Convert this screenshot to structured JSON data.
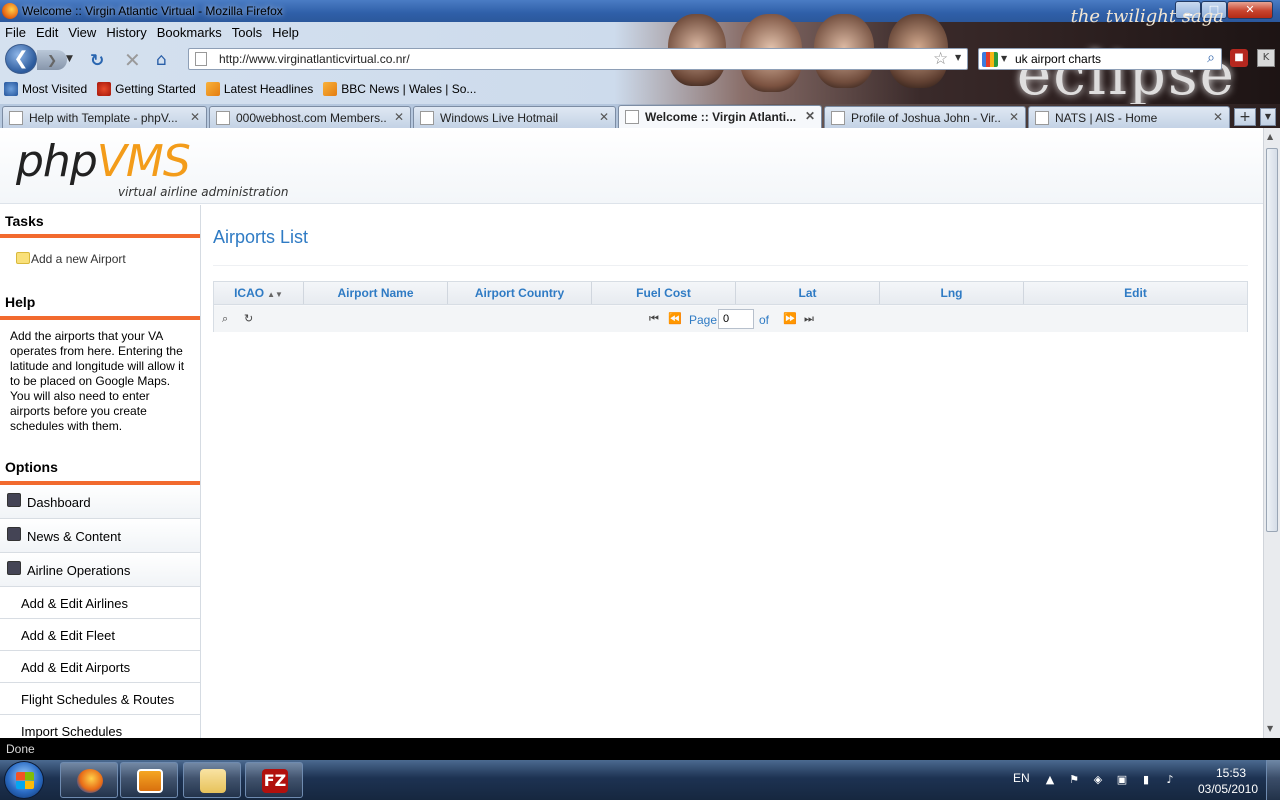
{
  "window": {
    "title": "Welcome :: Virgin Atlantic Virtual - Mozilla Firefox",
    "min_glyph": "▁",
    "max_glyph": "□",
    "close_glyph": "✕"
  },
  "menubar": [
    "File",
    "Edit",
    "View",
    "History",
    "Bookmarks",
    "Tools",
    "Help"
  ],
  "navbar": {
    "url": "http://www.virginatlanticvirtual.co.nr/",
    "search_query": "uk airport charts"
  },
  "persona": {
    "saga_text": "the twilight saga",
    "brand_text": "eclipse"
  },
  "bookmarks": [
    "Most Visited",
    "Getting Started",
    "Latest Headlines",
    "BBC News | Wales | So..."
  ],
  "tabs": [
    {
      "label": "Help with Template - phpV...",
      "active": false
    },
    {
      "label": "000webhost.com Members...",
      "active": false
    },
    {
      "label": "Windows Live Hotmail",
      "active": false
    },
    {
      "label": "Welcome :: Virgin Atlanti...",
      "active": true
    },
    {
      "label": "Profile of Joshua John - Vir...",
      "active": false
    },
    {
      "label": "NATS | AIS - Home",
      "active": false
    }
  ],
  "site": {
    "logo_php": "php",
    "logo_vms": "VMS",
    "tagline": "virtual airline administration"
  },
  "sidebar": {
    "tasks_heading": "Tasks",
    "task_add_airport": "Add a new Airport",
    "help_heading": "Help",
    "help_text": "Add the airports that your VA operates from here. Entering the latitude and longitude will allow it to be placed on Google Maps. You will also need to enter airports before you create schedules with them.",
    "options_heading": "Options",
    "options": [
      "Dashboard",
      "News & Content",
      "Airline Operations"
    ],
    "sub_options": [
      "Add & Edit Airlines",
      "Add & Edit Fleet",
      "Add & Edit Airports",
      "Flight Schedules & Routes",
      "Import Schedules"
    ]
  },
  "main": {
    "title": "Airports List",
    "columns": [
      "ICAO",
      "Airport Name",
      "Airport Country",
      "Fuel Cost",
      "Lat",
      "Lng",
      "Edit"
    ],
    "sort_indicator": "▲▼",
    "pager": {
      "page_label": "Page",
      "page_value": "0",
      "of_label": "of"
    }
  },
  "statusbar": {
    "text": "Done"
  },
  "taskbar": {
    "language": "EN",
    "time": "15:53",
    "date": "03/05/2010",
    "filezilla_label": "FZ"
  }
}
